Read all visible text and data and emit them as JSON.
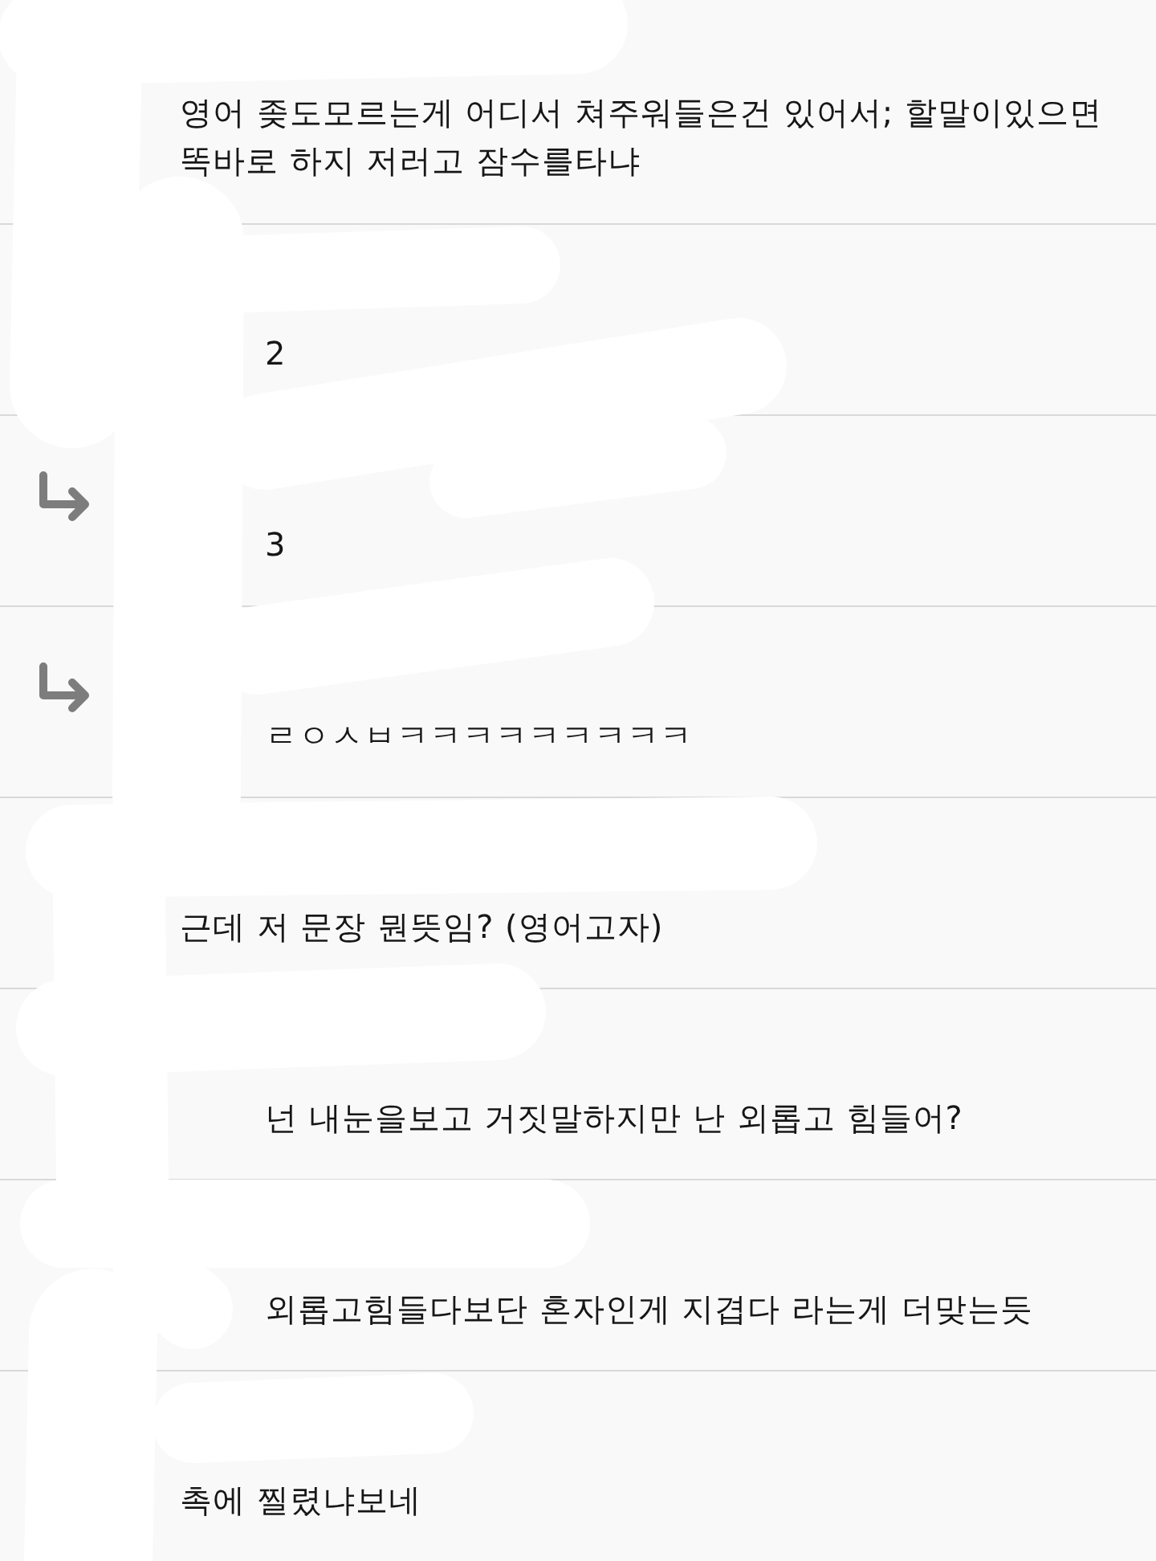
{
  "comments": [
    {
      "kind": "comment",
      "text": "영어 좆도모르는게 어디서 쳐주워들은건 있어서; 할말이있으면 똑바로 하지 저러고 잠수를타냐",
      "arrow": false
    },
    {
      "kind": "reply",
      "text": "2",
      "arrow": false
    },
    {
      "kind": "reply",
      "text": "3",
      "arrow": true
    },
    {
      "kind": "reply",
      "text": "ㄹㅇㅅㅂㅋㅋㅋㅋㅋㅋㅋㅋㅋ",
      "arrow": true
    },
    {
      "kind": "comment",
      "text": "근데 저 문장 뭔뜻임? (영어고자)",
      "arrow": false
    },
    {
      "kind": "reply",
      "text": "넌 내눈을보고 거짓말하지만 난 외롭고 힘들어?",
      "arrow": false
    },
    {
      "kind": "reply",
      "text": "외롭고힘들다보단 혼자인게 지겹다 라는게 더맞는듯",
      "arrow": false
    },
    {
      "kind": "comment",
      "text": "촉에 찔렸냐보네",
      "arrow": false
    }
  ]
}
